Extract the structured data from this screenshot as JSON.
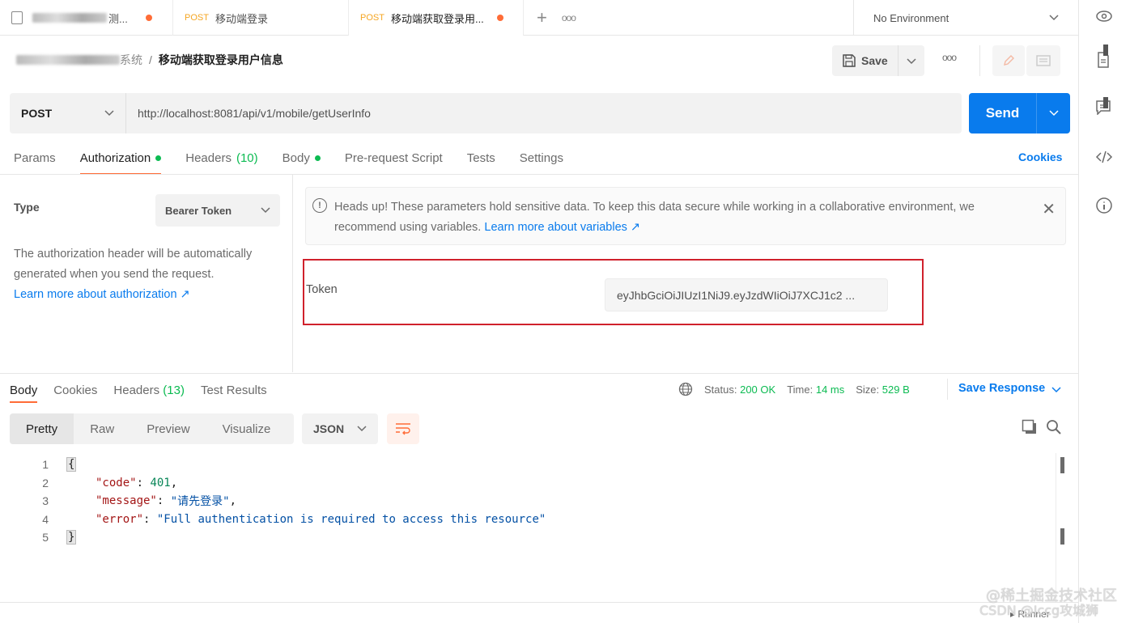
{
  "tabs": [
    {
      "method": "",
      "title": "测...",
      "unsaved": true
    },
    {
      "method": "POST",
      "title": "移动端登录",
      "unsaved": false
    },
    {
      "method": "POST",
      "title": "移动端获取登录用...",
      "unsaved": true
    }
  ],
  "new_tab_icon": "plus-icon",
  "more_icon": "more-icon",
  "environment": {
    "label": "No Environment"
  },
  "breadcrumb": {
    "collection": "系统",
    "separator": "/",
    "current": "移动端获取登录用户信息"
  },
  "toolbar": {
    "save_label": "Save",
    "more": "ooo"
  },
  "request": {
    "method": "POST",
    "url": "http://localhost:8081/api/v1/mobile/getUserInfo",
    "send_label": "Send"
  },
  "request_tabs": {
    "params": "Params",
    "authorization": "Authorization",
    "headers": "Headers",
    "headers_count": "(10)",
    "body": "Body",
    "prerequest": "Pre-request Script",
    "tests": "Tests",
    "settings": "Settings",
    "cookies": "Cookies"
  },
  "auth": {
    "type_label": "Type",
    "type_value": "Bearer Token",
    "description": "The authorization header will be automatically generated when you send the request.",
    "learn_more": "Learn more about authorization ↗",
    "notice": "Heads up! These parameters hold sensitive data. To keep this data secure while working in a collaborative environment, we recommend using variables.",
    "notice_link": "Learn more about variables ↗",
    "token_label": "Token",
    "token_value": "eyJhbGciOiJIUzI1NiJ9.eyJzdWIiOiJ7XCJ1c2 ..."
  },
  "response": {
    "tabs": {
      "body": "Body",
      "cookies": "Cookies",
      "headers": "Headers",
      "headers_count": "(13)",
      "test_results": "Test Results"
    },
    "status_label": "Status:",
    "status_value": "200 OK",
    "time_label": "Time:",
    "time_value": "14 ms",
    "size_label": "Size:",
    "size_value": "529 B",
    "save_response": "Save Response",
    "views": {
      "pretty": "Pretty",
      "raw": "Raw",
      "preview": "Preview",
      "visualize": "Visualize"
    },
    "format": "JSON",
    "lines": [
      {
        "n": "1",
        "open": "{"
      },
      {
        "n": "2",
        "key": "\"code\"",
        "sep": ": ",
        "val": "401",
        "trail": ","
      },
      {
        "n": "3",
        "key": "\"message\"",
        "sep": ": ",
        "val": "\"请先登录\"",
        "trail": ","
      },
      {
        "n": "4",
        "key": "\"error\"",
        "sep": ": ",
        "val": "\"Full authentication is required to access this resource\"",
        "trail": ""
      },
      {
        "n": "5",
        "close": "}"
      }
    ]
  },
  "footer": {
    "runner": "Runner"
  },
  "watermark": {
    "line1": "@稀土掘金技术社区",
    "line2": "CSDN @Iccg攻城狮"
  },
  "colors": {
    "accent": "#ff6c37",
    "primary": "#097bed",
    "success": "#0cbb52",
    "highlight_box": "#d0212c"
  }
}
